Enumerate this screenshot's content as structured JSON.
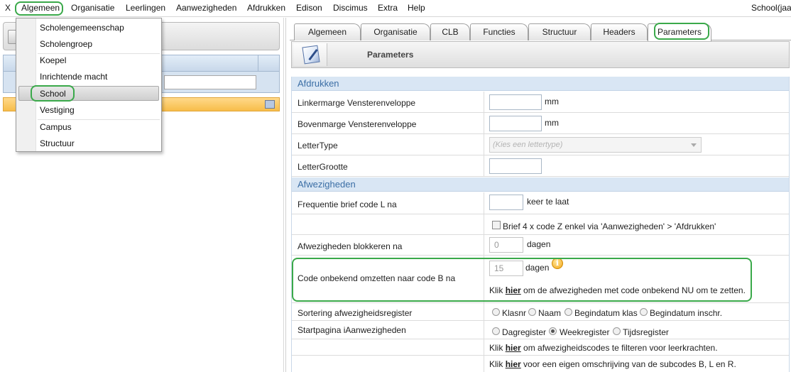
{
  "menubar": {
    "items": [
      "X",
      "Algemeen",
      "Organisatie",
      "Leerlingen",
      "Aanwezigheden",
      "Afdrukken",
      "Edison",
      "Discimus",
      "Extra",
      "Help"
    ],
    "right_text": "School(jaa"
  },
  "dropdown": {
    "items": [
      "Scholengemeenschap",
      "Scholengroep",
      "Koepel",
      "Inrichtende macht",
      "School",
      "Vestiging",
      "Campus",
      "Structuur"
    ],
    "selected": "School"
  },
  "tabs": [
    "Algemeen",
    "Organisatie",
    "CLB",
    "Functies",
    "Structuur",
    "Headers",
    "Parameters"
  ],
  "active_tab": "Parameters",
  "header": {
    "title": "Parameters"
  },
  "form": {
    "afdrukken": {
      "title": "Afdrukken",
      "linkermarge_label": "Linkermarge Vensterenveloppe",
      "linkermarge_unit": "mm",
      "bovenmarge_label": "Bovenmarge Vensterenveloppe",
      "bovenmarge_unit": "mm",
      "lettertype_label": "LetterType",
      "lettertype_placeholder": "(Kies een lettertype)",
      "lettergrootte_label": "LetterGrootte"
    },
    "afwezigheden": {
      "title": "Afwezigheden",
      "frequentie_label": "Frequentie brief code L na",
      "frequentie_unit": "keer te laat",
      "brief_checkbox_label": "Brief 4 x code Z enkel via 'Aanwezigheden' > 'Afdrukken'",
      "blokkeren_label": "Afwezigheden blokkeren na",
      "blokkeren_value": "0",
      "blokkeren_unit": "dagen",
      "code_onbekend_label": "Code onbekend omzetten naar code B na",
      "code_onbekend_value": "15",
      "code_onbekend_unit": "dagen",
      "klik1_pre": "Klik",
      "klik1_link": "hier",
      "klik1_post": "om de afwezigheden met code onbekend NU om te zetten.",
      "sortering_label": "Sortering afwezigheidsregister",
      "sortering_options": [
        "Klasnr",
        "Naam",
        "Begindatum klas",
        "Begindatum inschr."
      ],
      "startpagina_label": "Startpagina iAanwezigheden",
      "startpagina_options": [
        "Dagregister",
        "Weekregister",
        "Tijdsregister"
      ],
      "startpagina_selected": "Weekregister",
      "klik2_pre": "Klik",
      "klik2_link": "hier",
      "klik2_post": "om afwezigheidscodes te filteren voor leerkrachten.",
      "klik3_pre": "Klik",
      "klik3_link": "hier",
      "klik3_post": "voor een eigen omschrijving van de subcodes B, L en R."
    }
  },
  "colors": {
    "highlight_green": "#3aa94a",
    "section_blue": "#3b6ea5",
    "selected_row": "#f7bd4a"
  }
}
